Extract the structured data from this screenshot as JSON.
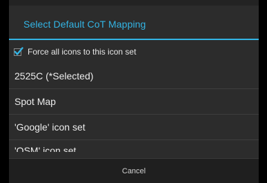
{
  "dialog": {
    "title": "Select Default CoT Mapping",
    "accent_color": "#33b5e5",
    "force_checkbox": {
      "label": "Force all icons to this icon set",
      "checked": true,
      "icon": "checkbox-checked-icon"
    },
    "items": [
      {
        "label": "2525C (*Selected)"
      },
      {
        "label": "Spot Map"
      },
      {
        "label": "'Google' icon set"
      },
      {
        "label": "'OSM' icon set"
      }
    ],
    "cancel_label": "Cancel"
  }
}
